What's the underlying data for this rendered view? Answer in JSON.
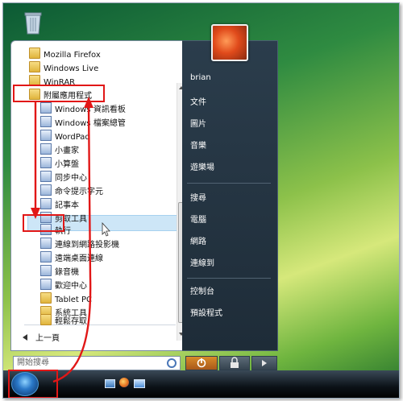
{
  "colors": {
    "highlight": "#cde6f7",
    "annotation_red": "#e11717",
    "right_panel": "#243441"
  },
  "desktop": {
    "recycle_bin_icon": "recycle-bin-icon"
  },
  "left_panel": {
    "items": [
      {
        "label": "Mozilla Firefox",
        "icon": "folder-icon"
      },
      {
        "label": "Windows Live",
        "icon": "folder-icon"
      },
      {
        "label": "WinRAR",
        "icon": "folder-icon"
      },
      {
        "label": "附屬應用程式",
        "icon": "folder-icon"
      },
      {
        "label": "Windows 資訊看板",
        "icon": "app-icon"
      },
      {
        "label": "Windows 檔案總管",
        "icon": "app-icon"
      },
      {
        "label": "WordPad",
        "icon": "app-icon"
      },
      {
        "label": "小畫家",
        "icon": "app-icon"
      },
      {
        "label": "小算盤",
        "icon": "app-icon"
      },
      {
        "label": "同步中心",
        "icon": "app-icon"
      },
      {
        "label": "命令提示字元",
        "icon": "app-icon"
      },
      {
        "label": "記事本",
        "icon": "app-icon"
      },
      {
        "label": "剪取工具",
        "icon": "app-icon"
      },
      {
        "label": "執行",
        "icon": "app-icon"
      },
      {
        "label": "連線到網路投影機",
        "icon": "app-icon"
      },
      {
        "label": "遠端桌面連線",
        "icon": "app-icon"
      },
      {
        "label": "錄音機",
        "icon": "app-icon"
      },
      {
        "label": "歡迎中心",
        "icon": "app-icon"
      },
      {
        "label": "Tablet PC",
        "icon": "folder-icon"
      },
      {
        "label": "系統工具",
        "icon": "folder-icon"
      },
      {
        "label": "輕鬆存取",
        "icon": "folder-icon"
      }
    ],
    "back_label": "上一頁",
    "search_placeholder": "開始搜尋"
  },
  "right_panel": {
    "items": [
      "brian",
      "文件",
      "圖片",
      "音樂",
      "遊樂場",
      "搜尋",
      "電腦",
      "網路",
      "連線到",
      "控制台",
      "預設程式"
    ]
  },
  "taskbar": {
    "start_button": "start-orb-icon",
    "quick_launch": [
      "show-desktop-icon",
      "firefox-icon",
      "switch-windows-icon"
    ]
  }
}
